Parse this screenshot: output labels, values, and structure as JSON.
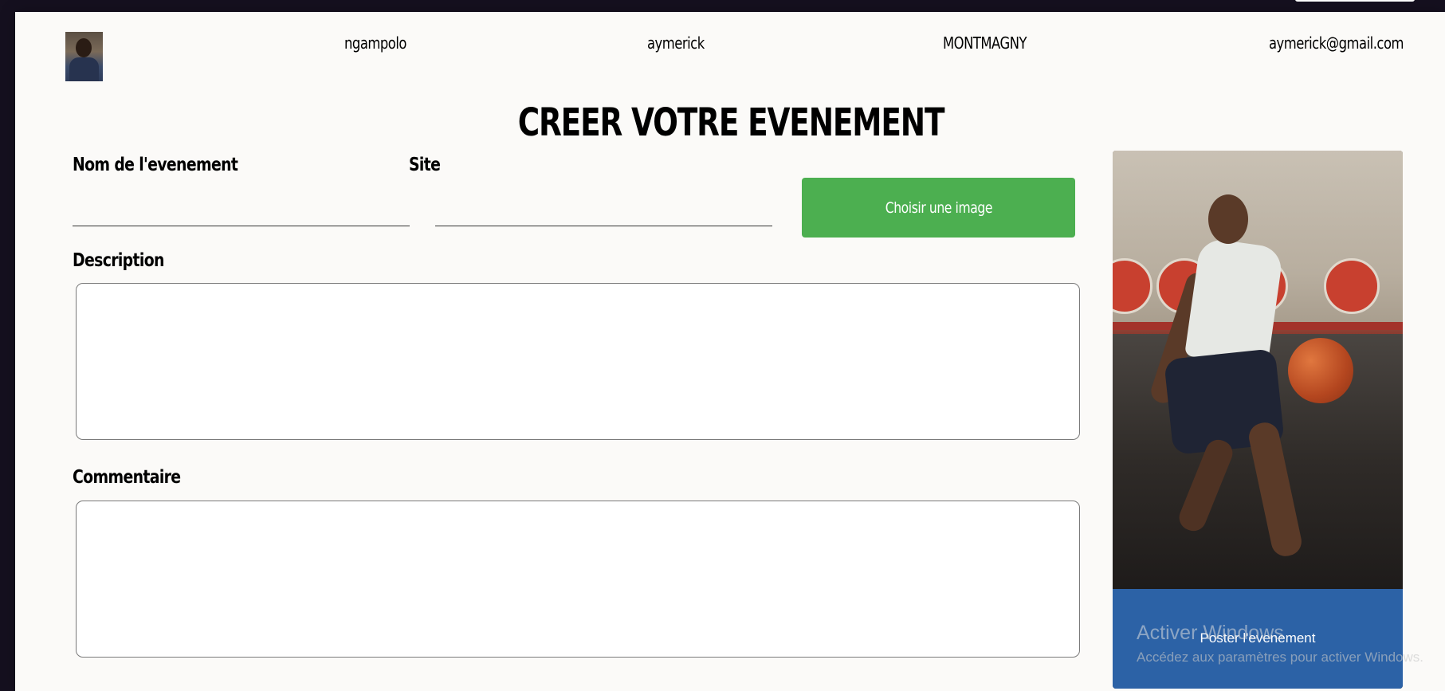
{
  "header": {
    "avatar_alt": "",
    "username": "ngampolo",
    "first_name": "aymerick",
    "city": "MONTMAGNY",
    "email": "aymerick@gmail.com"
  },
  "page": {
    "title": "CREER VOTRE EVENEMENT"
  },
  "form": {
    "event_name_label": "Nom de l'evenement",
    "event_name_value": "",
    "site_label": "Site",
    "site_value": "",
    "choose_image_label": "Choisir une image",
    "description_label": "Description",
    "description_value": "",
    "comment_label": "Commentaire",
    "comment_value": ""
  },
  "preview_card": {
    "image_subject": "basketball-player",
    "post_button_label": "Poster l'evenement",
    "footer_color": "#2c62a6"
  },
  "os_watermark": {
    "title": "Activer Windows",
    "subtitle": "Accédez aux paramètres pour activer Windows."
  },
  "colors": {
    "accent_green": "#4caf50",
    "accent_blue": "#2c62a6",
    "page_background": "#fbfaf8",
    "frame_background": "#15101f"
  }
}
